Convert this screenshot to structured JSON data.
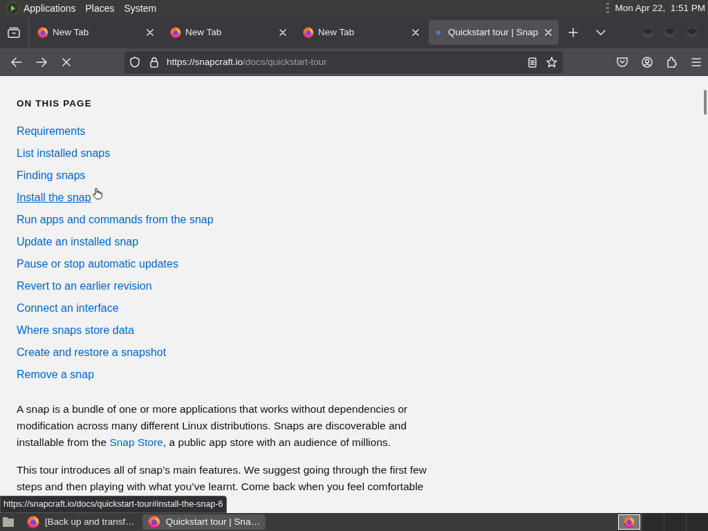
{
  "top_panel": {
    "menus": [
      "Applications",
      "Places",
      "System"
    ],
    "clock": "Mon Apr 22,  1:51 PM"
  },
  "tabs": [
    {
      "title": "New Tab",
      "selected": false,
      "loading": false
    },
    {
      "title": "New Tab",
      "selected": false,
      "loading": false
    },
    {
      "title": "New Tab",
      "selected": false,
      "loading": false
    },
    {
      "title": "Quickstart tour | Snap",
      "selected": true,
      "loading": true
    }
  ],
  "address_bar": {
    "host": "https://snapcraft.io",
    "path": "/docs/quickstart-tour"
  },
  "page": {
    "toc_heading": "ON THIS PAGE",
    "toc_links": [
      {
        "label": "Requirements",
        "hovered": false
      },
      {
        "label": "List installed snaps",
        "hovered": false
      },
      {
        "label": "Finding snaps",
        "hovered": false
      },
      {
        "label": "Install the snap",
        "hovered": true
      },
      {
        "label": "Run apps and commands from the snap",
        "hovered": false
      },
      {
        "label": "Update an installed snap",
        "hovered": false
      },
      {
        "label": "Pause or stop automatic updates",
        "hovered": false
      },
      {
        "label": "Revert to an earlier revision",
        "hovered": false
      },
      {
        "label": "Connect an interface",
        "hovered": false
      },
      {
        "label": "Where snaps store data",
        "hovered": false
      },
      {
        "label": "Create and restore a snapshot",
        "hovered": false
      },
      {
        "label": "Remove a snap",
        "hovered": false
      }
    ],
    "paragraphs": [
      {
        "before": "A snap is a bundle of one or more applications that works without dependencies or modification across many different Linux distributions. Snaps are discoverable and installable from the ",
        "link": "Snap Store",
        "after": ", a public app store with an audience of millions."
      },
      {
        "before": "This tour introduces all of snap’s main features. We suggest going through the first few steps and then playing with what you’ve learnt. Come back when you feel comfortable"
      }
    ]
  },
  "status_url": "https://snapcraft.io/docs/quickstart-tour#install-the-snap-6",
  "taskbar": [
    {
      "title": "[Back up and transf…",
      "selected": false
    },
    {
      "title": "Quickstart tour | Sna…",
      "selected": true
    }
  ]
}
